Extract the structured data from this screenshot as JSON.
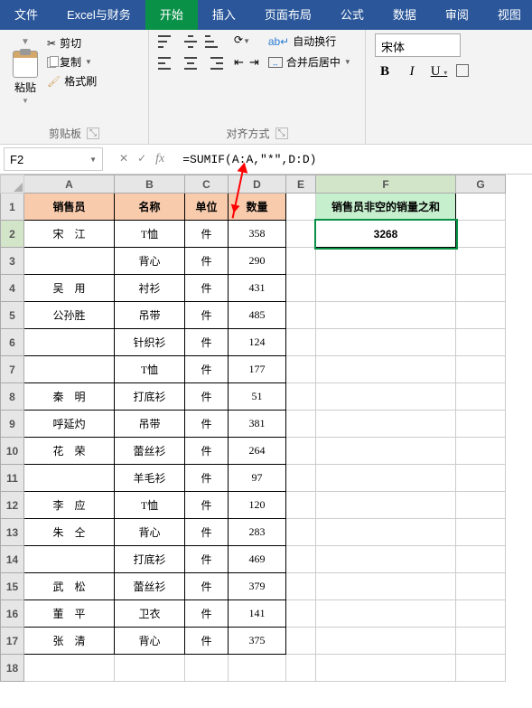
{
  "app": {
    "tabs": [
      "文件",
      "Excel与财务",
      "开始",
      "插入",
      "页面布局",
      "公式",
      "数据",
      "审阅",
      "视图"
    ],
    "active_tab": 2
  },
  "ribbon": {
    "clipboard": {
      "paste": "粘贴",
      "cut": "剪切",
      "copy": "复制",
      "format": "格式刷",
      "group": "剪贴板"
    },
    "align": {
      "wrap": "自动换行",
      "merge": "合并后居中",
      "group": "对齐方式"
    },
    "font": {
      "name": "宋体",
      "bold": "B",
      "italic": "I",
      "underline": "U"
    }
  },
  "formula_bar": {
    "cell_ref": "F2",
    "formula": "=SUMIF(A:A,\"*\",D:D)"
  },
  "columns": [
    "A",
    "B",
    "C",
    "D",
    "E",
    "F",
    "G"
  ],
  "headers": {
    "a": "销售员",
    "b": "名称",
    "c": "单位",
    "d": "数量"
  },
  "result": {
    "label": "销售员非空的销量之和",
    "value": "3268"
  },
  "rows": [
    {
      "a": "宋　江",
      "b": "T恤",
      "c": "件",
      "d": "358"
    },
    {
      "a": "",
      "b": "背心",
      "c": "件",
      "d": "290"
    },
    {
      "a": "吴　用",
      "b": "衬衫",
      "c": "件",
      "d": "431"
    },
    {
      "a": "公孙胜",
      "b": "吊带",
      "c": "件",
      "d": "485"
    },
    {
      "a": "",
      "b": "针织衫",
      "c": "件",
      "d": "124"
    },
    {
      "a": "",
      "b": "T恤",
      "c": "件",
      "d": "177"
    },
    {
      "a": "秦　明",
      "b": "打底衫",
      "c": "件",
      "d": "51"
    },
    {
      "a": "呼延灼",
      "b": "吊带",
      "c": "件",
      "d": "381"
    },
    {
      "a": "花　荣",
      "b": "蕾丝衫",
      "c": "件",
      "d": "264"
    },
    {
      "a": "",
      "b": "羊毛衫",
      "c": "件",
      "d": "97"
    },
    {
      "a": "李　应",
      "b": "T恤",
      "c": "件",
      "d": "120"
    },
    {
      "a": "朱　仝",
      "b": "背心",
      "c": "件",
      "d": "283"
    },
    {
      "a": "",
      "b": "打底衫",
      "c": "件",
      "d": "469"
    },
    {
      "a": "武　松",
      "b": "蕾丝衫",
      "c": "件",
      "d": "379"
    },
    {
      "a": "董　平",
      "b": "卫衣",
      "c": "件",
      "d": "141"
    },
    {
      "a": "张　清",
      "b": "背心",
      "c": "件",
      "d": "375"
    }
  ]
}
